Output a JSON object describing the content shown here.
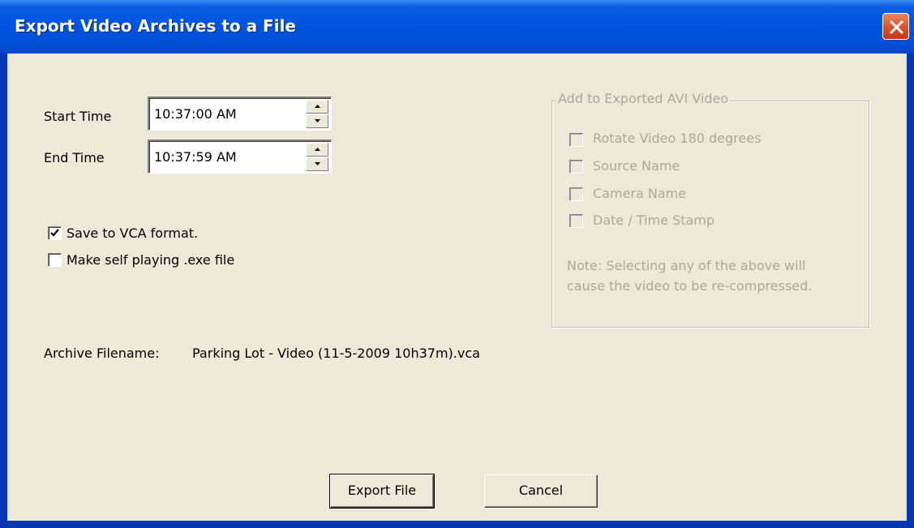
{
  "window": {
    "title": "Export Video Archives to a File"
  },
  "time_range": {
    "start_label": "Start Time",
    "start_value": "10:37:00 AM",
    "end_label": "End Time",
    "end_value": "10:37:59 AM"
  },
  "options": {
    "vca_format_label": "Save to VCA format.",
    "vca_format_checked": true,
    "self_playing_label": "Make self playing .exe file",
    "self_playing_checked": false
  },
  "avi_group": {
    "legend": "Add to Exported AVI Video",
    "rotate_label": "Rotate Video 180 degrees",
    "source_name_label": "Source Name",
    "camera_name_label": "Camera Name",
    "datetime_label": "Date / Time Stamp",
    "note_line1": "Note: Selecting any of the above will",
    "note_line2": "cause the video to be re-compressed."
  },
  "archive": {
    "label": "Archive Filename:",
    "filename": "Parking Lot - Video (11-5-2009 10h37m).vca"
  },
  "buttons": {
    "export_label": "Export File",
    "cancel_label": "Cancel"
  },
  "colors": {
    "titlebar": "#0054e3",
    "dialog_bg": "#ece9d8",
    "close_button": "#dc5a33",
    "disabled_text": "#aca899"
  }
}
